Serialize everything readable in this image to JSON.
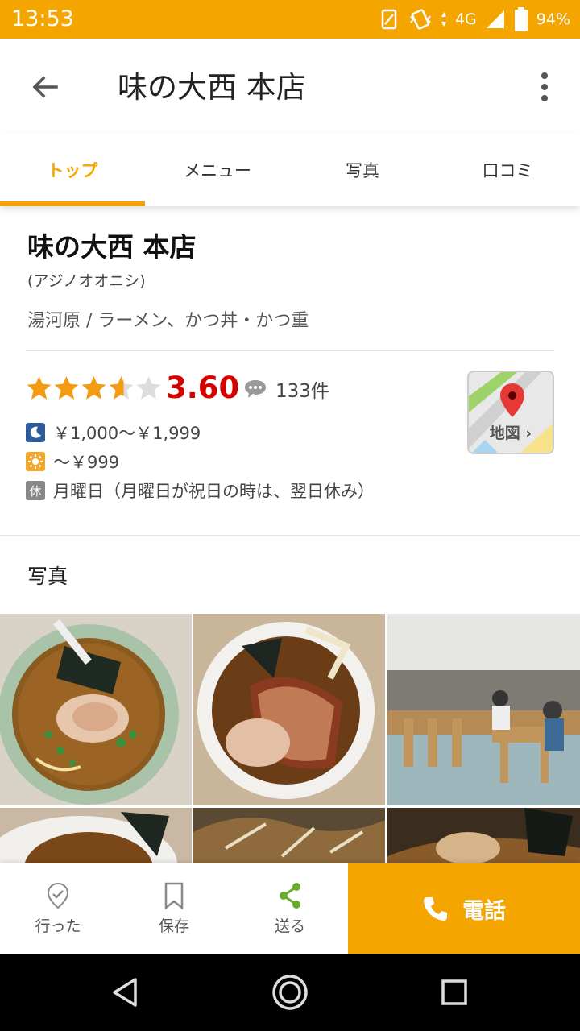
{
  "status_bar": {
    "time": "13:53",
    "network": "4G",
    "battery": "94%"
  },
  "header": {
    "title": "味の大西 本店"
  },
  "tabs": [
    {
      "label": "トップ",
      "active": true
    },
    {
      "label": "メニュー",
      "active": false
    },
    {
      "label": "写真",
      "active": false
    },
    {
      "label": "口コミ",
      "active": false
    }
  ],
  "store": {
    "name": "味の大西 本店",
    "kana": "(アジノオオニシ)",
    "area_genre": "湯河原 / ラーメン、かつ丼・かつ重",
    "rating": "3.60",
    "rating_value": 3.6,
    "review_count": "133件",
    "dinner_price": "￥1,000～￥1,999",
    "lunch_price": "～￥999",
    "closed_icon": "休",
    "closed_days": "月曜日（月曜日が祝日の時は、翌日休み）",
    "map_label": "地図 ›"
  },
  "photos": {
    "heading": "写真",
    "items": [
      "ramen-bowl-photo",
      "chashu-ramen-photo",
      "restaurant-interior-photo",
      "ramen-photo-4",
      "ramen-photo-5",
      "ramen-photo-6"
    ]
  },
  "actions": {
    "went": "行った",
    "save": "保存",
    "share": "送る",
    "call": "電話"
  },
  "colors": {
    "accent": "#f5a500",
    "rating": "#d50000",
    "star": "#f39c12"
  }
}
